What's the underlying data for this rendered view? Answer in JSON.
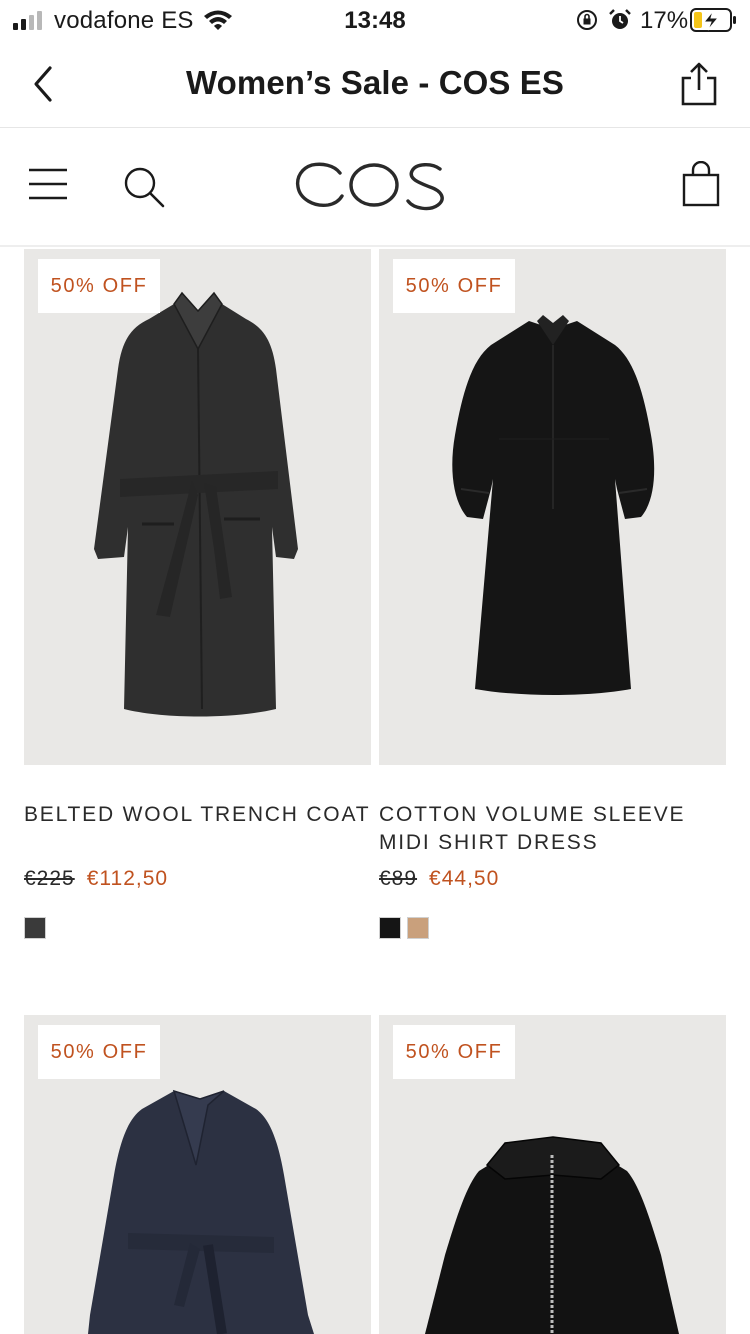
{
  "status_bar": {
    "carrier": "vodafone ES",
    "time": "13:48",
    "battery_percent": "17%",
    "icons": [
      "signal-icon",
      "wifi-icon",
      "orientation-lock-icon",
      "alarm-icon",
      "battery-charging-icon"
    ]
  },
  "navbar": {
    "title": "Women’s Sale - COS ES",
    "back_icon": "chevron-left-icon",
    "share_icon": "share-icon"
  },
  "site_header": {
    "logo_text": "COS",
    "menu_icon": "hamburger-menu-icon",
    "search_icon": "search-icon",
    "bag_icon": "shopping-bag-icon"
  },
  "colors": {
    "sale_accent": "#c0521f",
    "image_background": "#e9e8e6"
  },
  "products": [
    {
      "badge": "50% OFF",
      "name": "BELTED WOOL TRENCH COAT",
      "old_price": "€225",
      "new_price": "€112,50",
      "swatches": [
        "#3a3a3a"
      ]
    },
    {
      "badge": "50% OFF",
      "name": "COTTON VOLUME SLEEVE MIDI SHIRT DRESS",
      "old_price": "€89",
      "new_price": "€44,50",
      "swatches": [
        "#151515",
        "#c9a07c"
      ]
    },
    {
      "badge": "50% OFF"
    },
    {
      "badge": "50% OFF"
    }
  ]
}
